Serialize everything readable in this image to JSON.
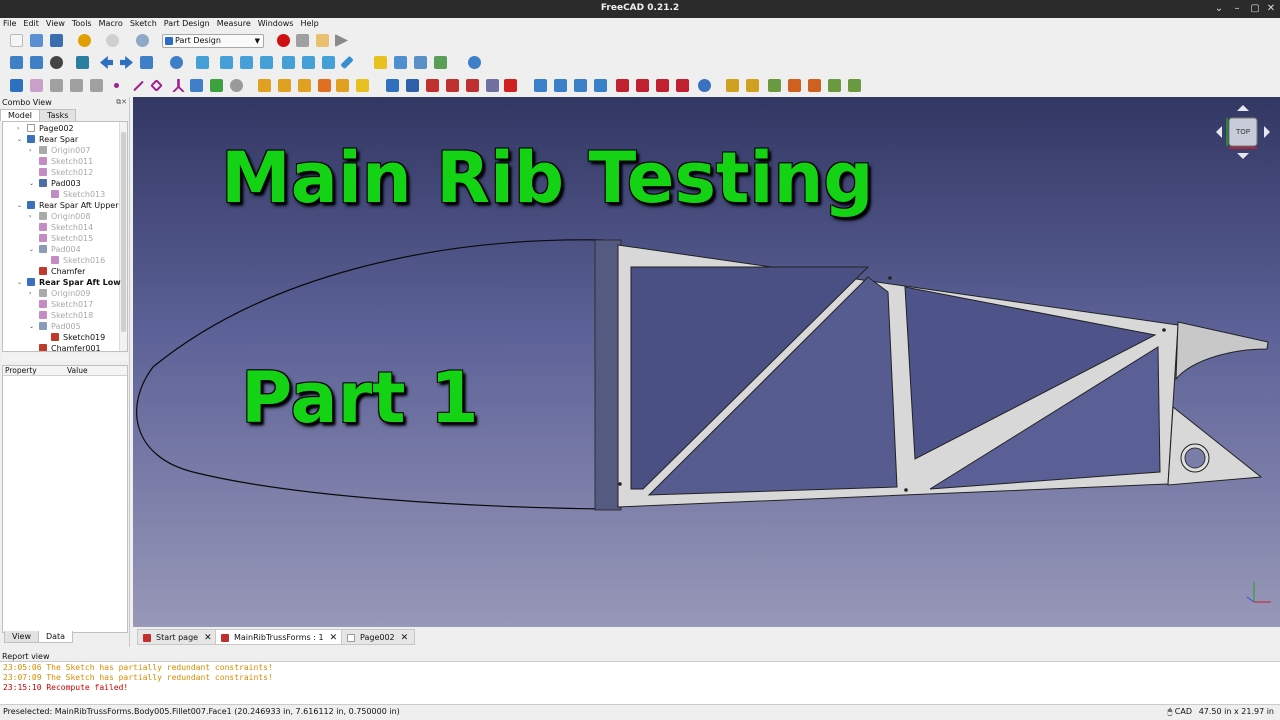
{
  "window": {
    "title": "FreeCAD 0.21.2",
    "controls": [
      "⌄",
      "–",
      "▢",
      "✕"
    ]
  },
  "menu": [
    "File",
    "Edit",
    "View",
    "Tools",
    "Macro",
    "Sketch",
    "Part Design",
    "Measure",
    "Windows",
    "Help"
  ],
  "toolbar": {
    "workbench": "Part Design"
  },
  "combo": {
    "title": "Combo View",
    "tabs": [
      "Model",
      "Tasks"
    ],
    "tree": [
      {
        "label": "Page002",
        "indent": 0,
        "exp": "›",
        "icon": "page-icon",
        "color": "#ffffff",
        "style": ""
      },
      {
        "label": "Rear Spar",
        "indent": 0,
        "exp": "⌄",
        "icon": "body-icon",
        "color": "#3b6fbf",
        "style": ""
      },
      {
        "label": "Origin007",
        "indent": 1,
        "exp": "›",
        "icon": "origin-icon",
        "color": "#aaaaaa",
        "style": "dim"
      },
      {
        "label": "Sketch011",
        "indent": 1,
        "exp": "",
        "icon": "sketch-icon",
        "color": "#c48bc4",
        "style": "dim"
      },
      {
        "label": "Sketch012",
        "indent": 1,
        "exp": "",
        "icon": "sketch-icon",
        "color": "#c48bc4",
        "style": "dim"
      },
      {
        "label": "Pad003",
        "indent": 1,
        "exp": "⌄",
        "icon": "pad-icon",
        "color": "#4f6fa8",
        "style": ""
      },
      {
        "label": "Sketch013",
        "indent": 2,
        "exp": "",
        "icon": "sketch-icon",
        "color": "#c48bc4",
        "style": "dim"
      },
      {
        "label": "Rear Spar Aft Upper S",
        "indent": 0,
        "exp": "⌄",
        "icon": "body-icon",
        "color": "#3b6fbf",
        "style": ""
      },
      {
        "label": "Origin008",
        "indent": 1,
        "exp": "›",
        "icon": "origin-icon",
        "color": "#aaaaaa",
        "style": "dim"
      },
      {
        "label": "Sketch014",
        "indent": 1,
        "exp": "",
        "icon": "sketch-icon",
        "color": "#c48bc4",
        "style": "dim"
      },
      {
        "label": "Sketch015",
        "indent": 1,
        "exp": "",
        "icon": "sketch-icon",
        "color": "#c48bc4",
        "style": "dim"
      },
      {
        "label": "Pad004",
        "indent": 1,
        "exp": "⌄",
        "icon": "pad-icon",
        "color": "#8a9bb8",
        "style": "dim"
      },
      {
        "label": "Sketch016",
        "indent": 2,
        "exp": "",
        "icon": "sketch-icon",
        "color": "#c48bc4",
        "style": "dim"
      },
      {
        "label": "Chamfer",
        "indent": 1,
        "exp": "",
        "icon": "chamfer-icon",
        "color": "#c0392b",
        "style": ""
      },
      {
        "label": "Rear Spar Aft Lowe",
        "indent": 0,
        "exp": "⌄",
        "icon": "body-icon",
        "color": "#3b6fbf",
        "style": "bold"
      },
      {
        "label": "Origin009",
        "indent": 1,
        "exp": "›",
        "icon": "origin-icon",
        "color": "#aaaaaa",
        "style": "dim"
      },
      {
        "label": "Sketch017",
        "indent": 1,
        "exp": "",
        "icon": "sketch-icon",
        "color": "#c48bc4",
        "style": "dim"
      },
      {
        "label": "Sketch018",
        "indent": 1,
        "exp": "",
        "icon": "sketch-icon",
        "color": "#c48bc4",
        "style": "dim"
      },
      {
        "label": "Pad005",
        "indent": 1,
        "exp": "⌄",
        "icon": "pad-icon",
        "color": "#8a9bb8",
        "style": "dim"
      },
      {
        "label": "Sketch019",
        "indent": 2,
        "exp": "",
        "icon": "sketch-icon",
        "color": "#c0392b",
        "style": ""
      },
      {
        "label": "Chamfer001",
        "indent": 1,
        "exp": "",
        "icon": "chamfer-icon",
        "color": "#c0392b",
        "style": ""
      }
    ],
    "property_headers": [
      "Property",
      "Value"
    ],
    "bottom_tabs": [
      "View",
      "Data"
    ]
  },
  "viewport": {
    "headline_1": "Main Rib Testing",
    "headline_2": "Part 1",
    "navcube_face": "TOP"
  },
  "doc_tabs": [
    {
      "label": "Start page",
      "icon": "freecad-icon",
      "active": false
    },
    {
      "label": "MainRibTrussForms : 1",
      "icon": "freecad-icon",
      "active": true
    },
    {
      "label": "Page002",
      "icon": "page-icon",
      "active": false
    }
  ],
  "report": {
    "title": "Report view",
    "lines": [
      {
        "time": "23:05:06",
        "text": "The Sketch has partially redundant constraints!",
        "color": "#d98c00"
      },
      {
        "time": "23:07:09",
        "text": "The Sketch has partially redundant constraints!",
        "color": "#d98c00"
      },
      {
        "time": "23:15:10",
        "text": "Recompute failed!",
        "color": "#d00000"
      }
    ]
  },
  "status": {
    "message": "Preselected: MainRibTrussForms.Body005.Fillet007.Face1 (20.246933 in, 7.616112 in, 0.750000 in)",
    "navigation": "CAD",
    "dimensions": "47.50 in x 21.97 in"
  }
}
